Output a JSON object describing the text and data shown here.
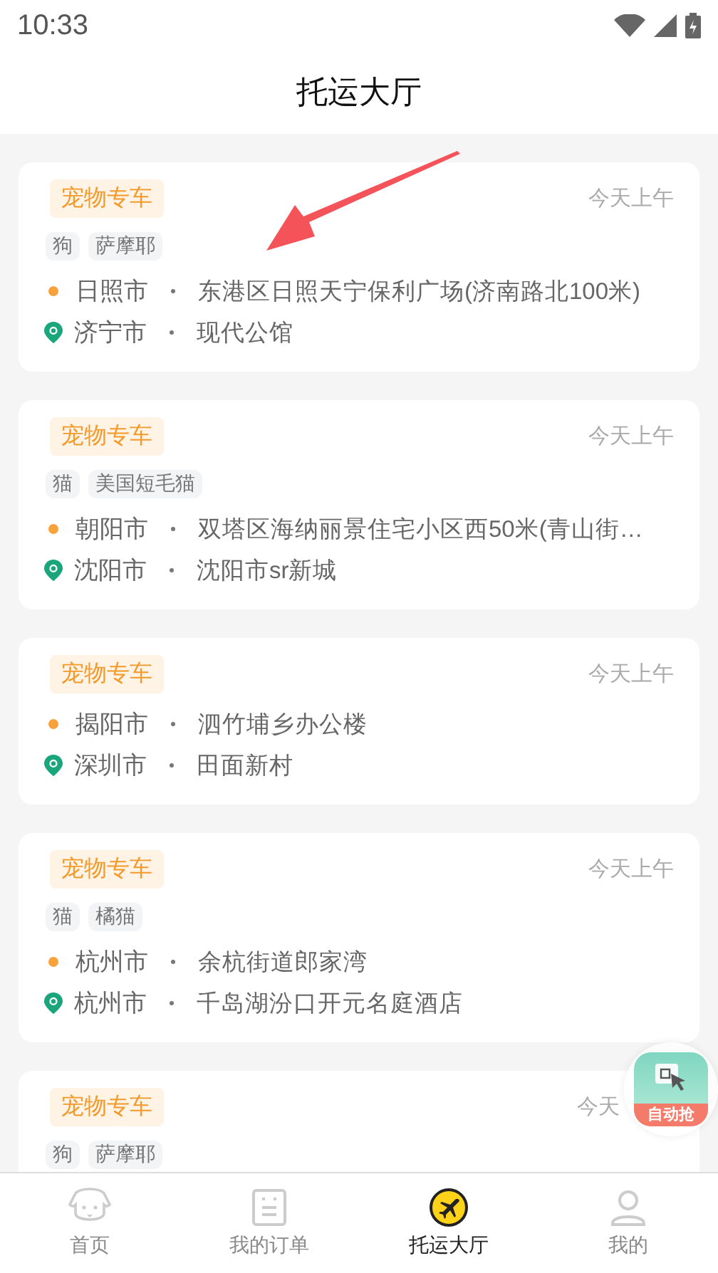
{
  "status_bar": {
    "time": "10:33"
  },
  "header": {
    "title": "托运大厅"
  },
  "orders": [
    {
      "badge": "宠物专车",
      "time": "今天上午",
      "tags": [
        "狗",
        "萨摩耶"
      ],
      "from": {
        "city": "日照市",
        "address": "东港区日照天宁保利广场(济南路北100米)"
      },
      "to": {
        "city": "济宁市",
        "address": "现代公馆"
      }
    },
    {
      "badge": "宠物专车",
      "time": "今天上午",
      "tags": [
        "猫",
        "美国短毛猫"
      ],
      "from": {
        "city": "朝阳市",
        "address": "双塔区海纳丽景住宅小区西50米(青山街…"
      },
      "to": {
        "city": "沈阳市",
        "address": "沈阳市sr新城"
      }
    },
    {
      "badge": "宠物专车",
      "time": "今天上午",
      "from": {
        "city": "揭阳市",
        "address": "泗竹埔乡办公楼"
      },
      "to": {
        "city": "深圳市",
        "address": "田面新村"
      }
    },
    {
      "badge": "宠物专车",
      "time": "今天上午",
      "tags": [
        "猫",
        "橘猫"
      ],
      "from": {
        "city": "杭州市",
        "address": "余杭街道郎家湾"
      },
      "to": {
        "city": "杭州市",
        "address": "千岛湖汾口开元名庭酒店"
      }
    },
    {
      "badge": "宠物专车",
      "time": "今天",
      "tags": [
        "狗",
        "萨摩耶"
      ]
    }
  ],
  "floating_button": {
    "label": "自动抢"
  },
  "tab_bar": [
    {
      "kind": "home",
      "label": "首页",
      "selected": false
    },
    {
      "kind": "orders",
      "label": "我的订单",
      "selected": false
    },
    {
      "kind": "hall",
      "label": "托运大厅",
      "selected": true
    },
    {
      "kind": "me",
      "label": "我的",
      "selected": false
    }
  ]
}
